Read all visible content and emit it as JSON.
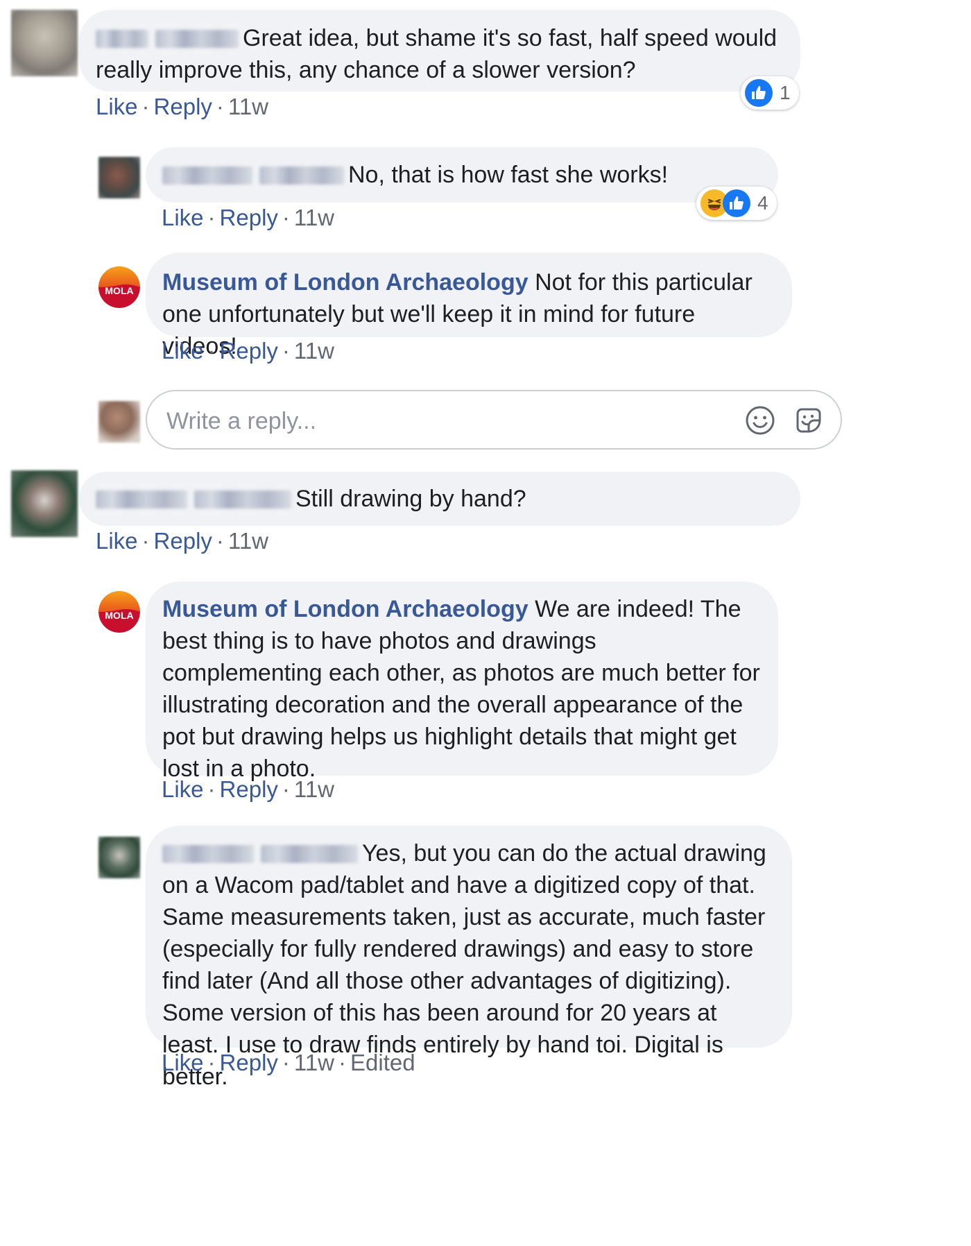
{
  "actions": {
    "like": "Like",
    "reply": "Reply",
    "separator": "·"
  },
  "comments": [
    {
      "text": "Great idea, but shame it's so fast, half speed would really improve this, any chance of a slower version?",
      "time": "11w",
      "reactions": {
        "icons": [
          "like-icon"
        ],
        "count": "1"
      }
    },
    {
      "text": "No, that is how fast she works!",
      "time": "11w",
      "reactions": {
        "icons": [
          "haha-icon",
          "like-icon"
        ],
        "count": "4"
      }
    },
    {
      "author": "Museum of London Archaeology",
      "avatar_text": "MOLA",
      "text": "Not for this particular one unfortunately but we'll keep it in mind for future videos!",
      "time": "11w"
    },
    {
      "text": "Still drawing by hand?",
      "time": "11w"
    },
    {
      "author": "Museum of London Archaeology",
      "avatar_text": "MOLA",
      "text": "We are indeed! The best thing is to have photos and drawings complementing each other, as photos are much better for illustrating decoration and the overall appearance of the pot but drawing helps us highlight details that might get lost in a photo.",
      "time": "11w"
    },
    {
      "text": "Yes, but you can do the actual drawing on a Wacom pad/tablet and have a digitized copy of that. Same measurements taken, just as accurate, much faster (especially for fully rendered drawings) and easy to store find later (And all those other advantages of digitizing). Some version of this has been around for 20 years at least. I use to draw finds entirely by hand toi. Digital is better.",
      "time": "11w",
      "edited": "Edited"
    }
  ],
  "reply_box": {
    "placeholder": "Write a reply..."
  },
  "colors": {
    "link": "#385898",
    "bubble": "#f0f2f5",
    "meta": "#606770",
    "like_blue": "#1877f2",
    "haha_yellow": "#f7b928",
    "mola_red": "#c8102e"
  }
}
